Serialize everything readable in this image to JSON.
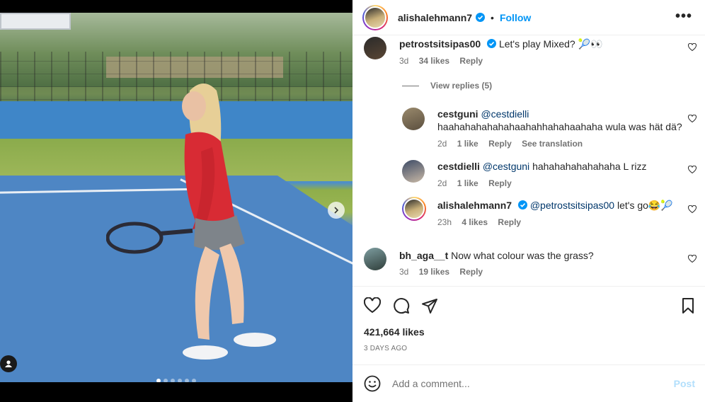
{
  "post": {
    "author": "alishalehmann7",
    "follow_label": "Follow",
    "bullet": "•",
    "more_label": "•••",
    "carousel": {
      "slides": 6,
      "active": 0
    },
    "likes": "421,664 likes",
    "date": "3 DAYS AGO"
  },
  "comments": [
    {
      "user": "petrostsitsipas00",
      "verified": true,
      "text": "Let's play Mixed? 🎾👀",
      "time": "3d",
      "likes": "34 likes",
      "reply": "Reply"
    },
    {
      "view_replies": "View replies (5)"
    },
    {
      "user": "cestguni",
      "mention": "@cestdielli",
      "text": "haahahahahahahaahahhahahaahaha wula was hät dä?",
      "time": "2d",
      "likes": "1 like",
      "reply": "Reply",
      "translate": "See translation"
    },
    {
      "user": "cestdielli",
      "mention": "@cestguni",
      "text": "hahahahahahahaha L rizz",
      "time": "2d",
      "likes": "1 like",
      "reply": "Reply"
    },
    {
      "user": "alishalehmann7",
      "verified": true,
      "mention": "@petrostsitsipas00",
      "text": "let's go😂🎾",
      "time": "23h",
      "likes": "4 likes",
      "reply": "Reply"
    },
    {
      "user": "bh_aga__t",
      "text": "Now what colour was the grass?",
      "time": "3d",
      "likes": "19 likes",
      "reply": "Reply"
    }
  ],
  "composer": {
    "placeholder": "Add a comment...",
    "post_label": "Post"
  },
  "icons": [
    "verified-icon",
    "more-icon",
    "heart-icon",
    "comment-icon",
    "share-icon",
    "bookmark-icon",
    "emoji-icon",
    "chevron-right-icon",
    "user-tag-icon"
  ],
  "colors": {
    "accent": "#0095f6",
    "text": "#262626",
    "muted": "#737373",
    "mention": "#00376b",
    "post_disabled": "#b2dffc"
  }
}
